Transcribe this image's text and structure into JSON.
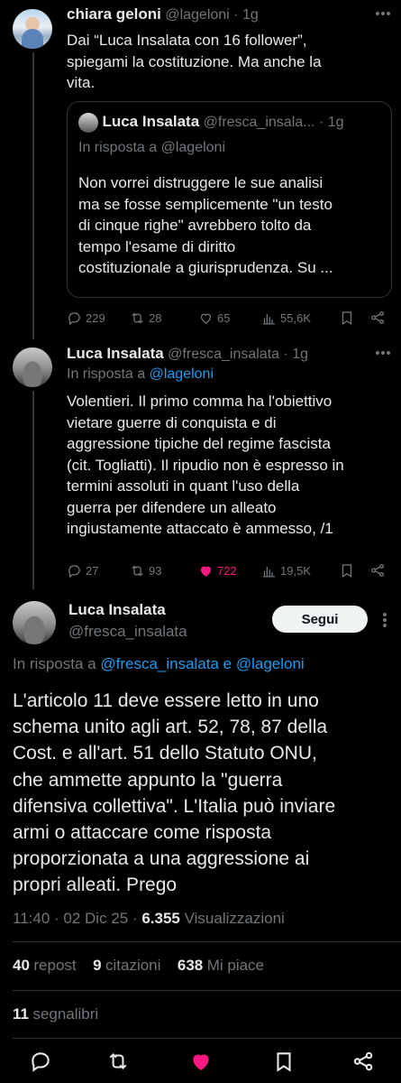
{
  "tweet1": {
    "name": "chiara geloni",
    "handle": "@lageloni",
    "time": "· 1g",
    "lines": [
      "Dai “Luca Insalata con 16 follower”,",
      "spiegami la costituzione. Ma anche la",
      "vita."
    ],
    "quote": {
      "name": "Luca Insalata",
      "handle": "@fresca_insala...",
      "time": "· 1g",
      "reply_prefix": "In risposta a",
      "reply_to": "@lageloni",
      "lines": [
        "Non vorrei distruggere le sue analisi",
        "ma se fosse semplicemente \"un testo",
        "di cinque righe\" avrebbero tolto da",
        "tempo l'esame di diritto",
        "costituzionale a giurisprudenza. Su ..."
      ]
    },
    "replies": "229",
    "reposts": "28",
    "likes": "65",
    "views": "55,6K"
  },
  "tweet2": {
    "name": "Luca Insalata",
    "handle": "@fresca_insalata",
    "time": "· 1g",
    "reply_prefix": "In risposta a",
    "reply_to": "@lageloni",
    "lines": [
      "Volentieri. Il primo comma ha l'obiettivo",
      "vietare guerre di conquista e di",
      "aggressione tipiche del regime fascista",
      "(cit. Togliatti). Il ripudio non è espresso in",
      "termini assoluti in quant l'uso della",
      "guerra per difendere un alleato",
      "ingiustamente attaccato è ammesso, /1"
    ],
    "replies": "27",
    "reposts": "93",
    "likes": "722",
    "views": "19,5K"
  },
  "main": {
    "name": "Luca Insalata",
    "handle": "@fresca_insalata",
    "follow_label": "Segui",
    "reply_prefix": "In risposta a",
    "reply_to": "@fresca_insalata e @lageloni",
    "lines": [
      "L'articolo 11 deve essere letto in uno",
      "schema unito agli art. 52, 78, 87 della",
      "Cost. e all'art. 51 dello Statuto ONU,",
      "che ammette appunto la \"guerra",
      "difensiva collettiva\". L'Italia può inviare",
      "armi o attaccare come risposta",
      "proporzionata a una aggressione ai",
      "propri alleati. Prego"
    ],
    "meta_time": "11:40 · 02 Dic 25 ·",
    "meta_views_num": "6.355",
    "meta_views_lbl": "Visualizzazioni",
    "repost_num": "40",
    "repost_lbl": "repost",
    "quote_num": "9",
    "quote_lbl": "citazioni",
    "like_num": "638",
    "like_lbl": "Mi piace",
    "bookmark_num": "11",
    "bookmark_lbl": "segnalibri"
  },
  "colors": {
    "accent": "#1d9bf0",
    "like": "#f91880",
    "background": "#000000"
  },
  "icons": [
    "reply-icon",
    "repost-icon",
    "like-icon",
    "views-icon",
    "bookmark-icon",
    "share-icon"
  ]
}
